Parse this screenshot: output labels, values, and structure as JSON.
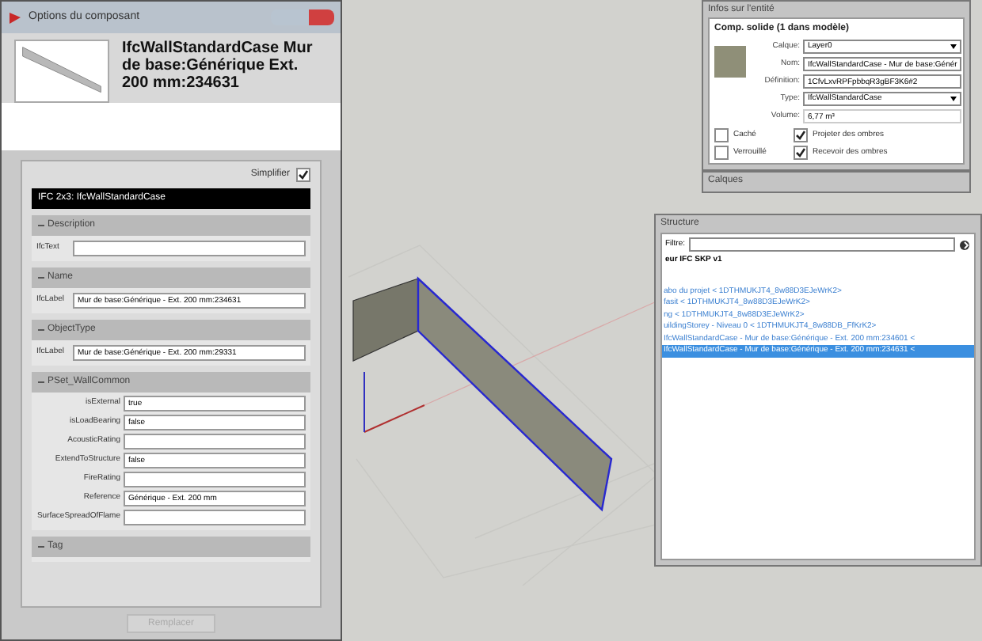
{
  "component_dialog": {
    "title": "Options du composant",
    "heading": "IfcWallStandardCase Mur de base:Générique Ext. 200 mm:234631",
    "simplify": {
      "label": "Simplifier",
      "checked": true
    },
    "schema_bar": "IFC 2x3: IfcWallStandardCase",
    "sections": [
      {
        "title": "Description",
        "kind": "single",
        "fields": [
          {
            "label": "IfcText"
          }
        ]
      },
      {
        "title": "Name",
        "kind": "single",
        "fields": [
          {
            "label": "IfcLabel",
            "value": "Mur de base:Générique - Ext. 200 mm:234631"
          }
        ]
      },
      {
        "title": "ObjectType",
        "kind": "single",
        "fields": [
          {
            "label": "IfcLabel",
            "value": "Mur de base:Générique - Ext. 200 mm:29331"
          }
        ]
      },
      {
        "title": "PSet_WallCommon",
        "kind": "properties",
        "fields": [
          {
            "label": "isExternal",
            "value": "true"
          },
          {
            "label": "isLoadBearing",
            "value": "false"
          },
          {
            "label": "AcousticRating"
          },
          {
            "label": "ExtendToStructure",
            "value": "false"
          },
          {
            "label": "FireRating"
          },
          {
            "label": "Reference",
            "value": "Générique - Ext. 200 mm"
          },
          {
            "label": "SurfaceSpreadOfFlame"
          }
        ]
      },
      {
        "title": "Tag",
        "kind": "collapsed"
      }
    ],
    "replace_button": {
      "label": "Remplacer",
      "disabled": true
    }
  },
  "entity_info": {
    "title": "Infos sur l'entité",
    "summary": "Comp. solide (1 dans modèle)",
    "fields": [
      {
        "label": "Calque:",
        "value": "Layer0",
        "kind": "dropdown"
      },
      {
        "label": "Nom:",
        "value": "IfcWallStandardCase - Mur de base:Génér",
        "kind": "text"
      },
      {
        "label": "Définition:",
        "value": "1CfvLxvRPFpbbqR3gBF3K6#2",
        "kind": "text"
      },
      {
        "label": "Type:",
        "value": "IfcWallStandardCase",
        "kind": "dropdown"
      },
      {
        "label": "Volume:",
        "value": "6,77 m³",
        "kind": "readonly"
      }
    ],
    "checkboxes": [
      {
        "label": "Caché",
        "checked": false
      },
      {
        "label": "Projeter des ombres",
        "checked": true
      },
      {
        "label": "Verrouillé",
        "checked": false
      },
      {
        "label": "Recevoir des ombres",
        "checked": true
      }
    ]
  },
  "layers_panel": {
    "title": "Calques"
  },
  "structure": {
    "title": "Structure",
    "filter_label": "Filtre:",
    "root": "eur IFC SKP v1",
    "items": [
      {
        "label": "abo du projet < 1DTHMUKJT4_8w88D3EJeWrK2>",
        "selected": false
      },
      {
        "label": "fasit < 1DTHMUKJT4_8w88D3EJeWrK2>",
        "selected": false
      },
      {
        "label": "ng < 1DTHMUKJT4_8w88D3EJeWrK2>",
        "selected": false
      },
      {
        "label": "uildingStorey - Niveau 0 < 1DTHMUKJT4_8w88DB_FfKrK2>",
        "selected": false
      },
      {
        "label": "IfcWallStandardCase - Mur de base:Générique - Ext. 200 mm:234601 <",
        "selected": false
      },
      {
        "label": "IfcWallStandardCase - Mur de base:Générique - Ext. 200 mm:234631 <",
        "selected": true
      }
    ]
  }
}
